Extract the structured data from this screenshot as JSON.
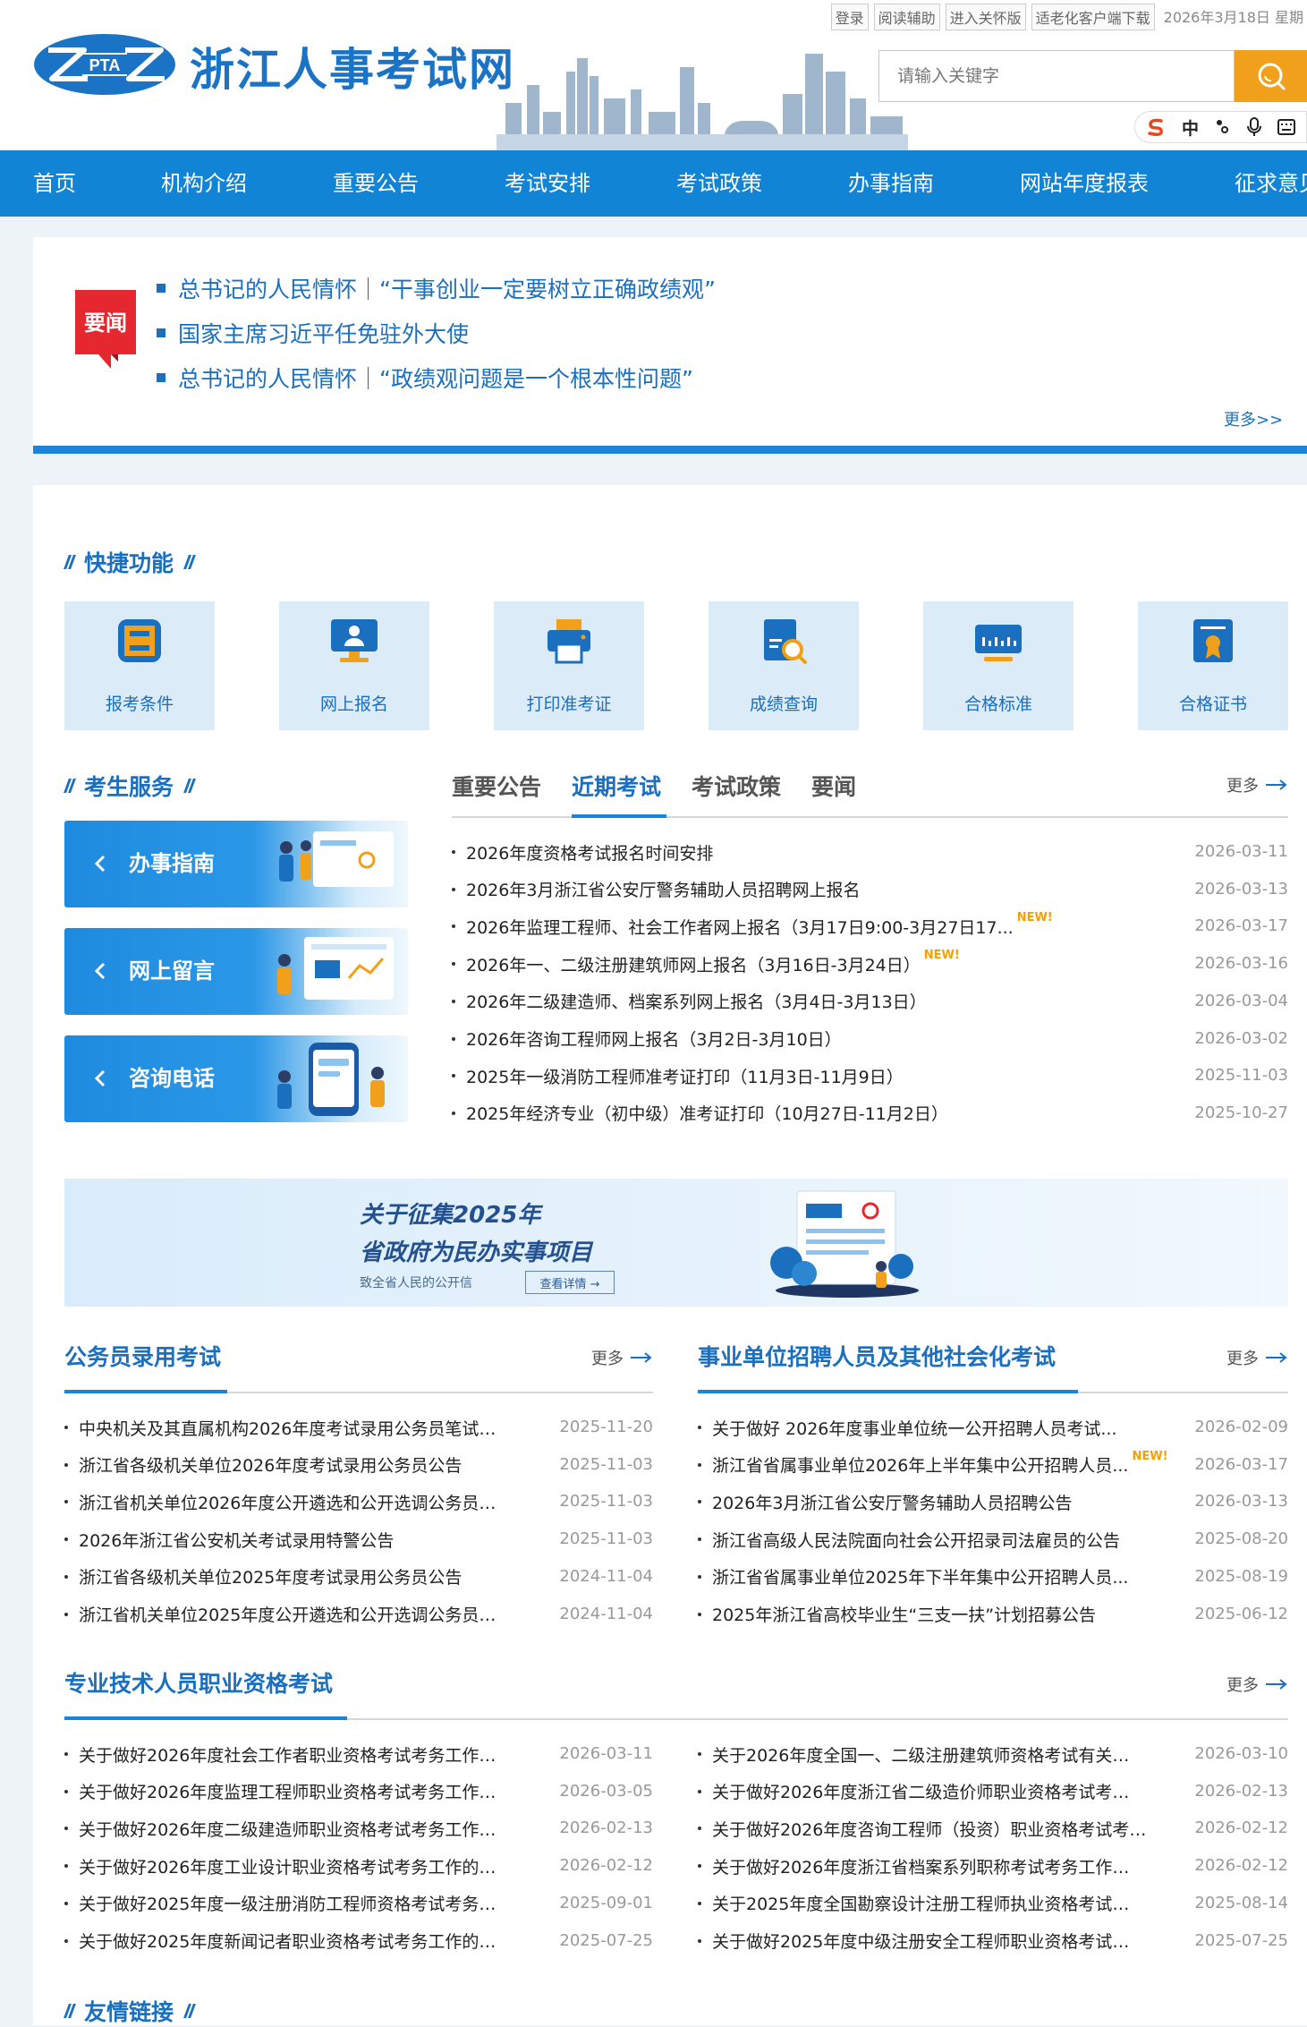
{
  "header": {
    "util_links": [
      "登录",
      "阅读辅助",
      "进入关怀版",
      "适老化客户端下载"
    ],
    "date": "2026年3月18日 星期",
    "site_title": "浙江人事考试网",
    "logo_text": "PTA",
    "search_placeholder": "请输入关键字",
    "toolbar_zh": "中"
  },
  "nav": {
    "items": [
      "首页",
      "机构介绍",
      "重要公告",
      "考试安排",
      "考试政策",
      "办事指南",
      "网站年度报表",
      "征求意见"
    ]
  },
  "news": {
    "badge": "要闻",
    "items": [
      "总书记的人民情怀｜“干事创业一定要树立正确政绩观”",
      "国家主席习近平任免驻外大使",
      "总书记的人民情怀｜“政绩观问题是一个根本性问题”"
    ],
    "more": "更多>>"
  },
  "quick": {
    "title": "快捷功能",
    "items": [
      {
        "label": "报考条件",
        "icon": "document-8-icon"
      },
      {
        "label": "网上报名",
        "icon": "computer-user-icon"
      },
      {
        "label": "打印准考证",
        "icon": "printer-icon"
      },
      {
        "label": "成绩查询",
        "icon": "score-search-icon"
      },
      {
        "label": "合格标准",
        "icon": "ruler-standard-icon"
      },
      {
        "label": "合格证书",
        "icon": "certificate-icon"
      }
    ]
  },
  "service": {
    "title": "考生服务",
    "items": [
      "办事指南",
      "网上留言",
      "咨询电话"
    ]
  },
  "tabs": {
    "items": [
      "重要公告",
      "近期考试",
      "考试政策",
      "要闻"
    ],
    "active": 1,
    "more": "更多",
    "list": [
      {
        "title": "2026年度资格考试报名时间安排",
        "date": "2026-03-11",
        "new": false
      },
      {
        "title": "2026年3月浙江省公安厅警务辅助人员招聘网上报名",
        "date": "2026-03-13",
        "new": false
      },
      {
        "title": "2026年监理工程师、社会工作者网上报名（3月17日9:00-3月27日17...",
        "date": "2026-03-17",
        "new": true
      },
      {
        "title": "2026年一、二级注册建筑师网上报名（3月16日-3月24日）",
        "date": "2026-03-16",
        "new": true
      },
      {
        "title": "2026年二级建造师、档案系列网上报名（3月4日-3月13日）",
        "date": "2026-03-04",
        "new": false
      },
      {
        "title": "2026年咨询工程师网上报名（3月2日-3月10日）",
        "date": "2026-03-02",
        "new": false
      },
      {
        "title": "2025年一级消防工程师准考证打印（11月3日-11月9日）",
        "date": "2025-11-03",
        "new": false
      },
      {
        "title": "2025年经济专业（初中级）准考证打印（10月27日-11月2日）",
        "date": "2025-10-27",
        "new": false
      }
    ]
  },
  "promo": {
    "line1": "关于征集2025年",
    "line2": "省政府为民办实事项目",
    "line3": "致全省人民的公开信",
    "button": "查看详情 →"
  },
  "civil": {
    "title": "公务员录用考试",
    "more": "更多",
    "list": [
      {
        "title": "中央机关及其直属机构2026年度考试录用公务员笔试…",
        "date": "2025-11-20"
      },
      {
        "title": "浙江省各级机关单位2026年度考试录用公务员公告",
        "date": "2025-11-03"
      },
      {
        "title": "浙江省机关单位2026年度公开遴选和公开选调公务员…",
        "date": "2025-11-03"
      },
      {
        "title": "2026年浙江省公安机关考试录用特警公告",
        "date": "2025-11-03"
      },
      {
        "title": "浙江省各级机关单位2025年度考试录用公务员公告",
        "date": "2024-11-04"
      },
      {
        "title": "浙江省机关单位2025年度公开遴选和公开选调公务员…",
        "date": "2024-11-04"
      }
    ]
  },
  "public_inst": {
    "title": "事业单位招聘人员及其他社会化考试",
    "more": "更多",
    "list": [
      {
        "title": "关于做好 2026年度事业单位统一公开招聘人员考试...",
        "date": "2026-02-09",
        "new": false
      },
      {
        "title": "浙江省省属事业单位2026年上半年集中公开招聘人员...",
        "date": "2026-03-17",
        "new": true
      },
      {
        "title": "2026年3月浙江省公安厅警务辅助人员招聘公告",
        "date": "2026-03-13",
        "new": false
      },
      {
        "title": "浙江省高级人民法院面向社会公开招录司法雇员的公告",
        "date": "2025-08-20",
        "new": false
      },
      {
        "title": "浙江省省属事业单位2025年下半年集中公开招聘人员...",
        "date": "2025-08-19",
        "new": false
      },
      {
        "title": "2025年浙江省高校毕业生“三支一扶”计划招募公告",
        "date": "2025-06-12",
        "new": false
      }
    ]
  },
  "professional": {
    "title": "专业技术人员职业资格考试",
    "more": "更多",
    "left": [
      {
        "title": "关于做好2026年度社会工作者职业资格考试考务工作…",
        "date": "2026-03-11"
      },
      {
        "title": "关于做好2026年度监理工程师职业资格考试考务工作…",
        "date": "2026-03-05"
      },
      {
        "title": "关于做好2026年度二级建造师职业资格考试考务工作…",
        "date": "2026-02-13"
      },
      {
        "title": "关于做好2026年度工业设计职业资格考试考务工作的…",
        "date": "2026-02-12"
      },
      {
        "title": "关于做好2025年度一级注册消防工程师资格考试考务…",
        "date": "2025-09-01"
      },
      {
        "title": "关于做好2025年度新闻记者职业资格考试考务工作的…",
        "date": "2025-07-25"
      }
    ],
    "right": [
      {
        "title": "关于2026年度全国一、二级注册建筑师资格考试有关…",
        "date": "2026-03-10"
      },
      {
        "title": "关于做好2026年度浙江省二级造价师职业资格考试考…",
        "date": "2026-02-13"
      },
      {
        "title": "关于做好2026年度咨询工程师（投资）职业资格考试考…",
        "date": "2026-02-12"
      },
      {
        "title": "关于做好2026年度浙江省档案系列职称考试考务工作…",
        "date": "2026-02-12"
      },
      {
        "title": "关于2025年度全国勘察设计注册工程师执业资格考试…",
        "date": "2025-08-14"
      },
      {
        "title": "关于做好2025年度中级注册安全工程师职业资格考试…",
        "date": "2025-07-25"
      }
    ]
  },
  "links": {
    "title": "友情链接"
  },
  "colors": {
    "primary": "#1184d6",
    "accent": "#f0a01a",
    "link": "#1a6fbf",
    "badge": "#e5282f",
    "new": "#f5a000"
  }
}
